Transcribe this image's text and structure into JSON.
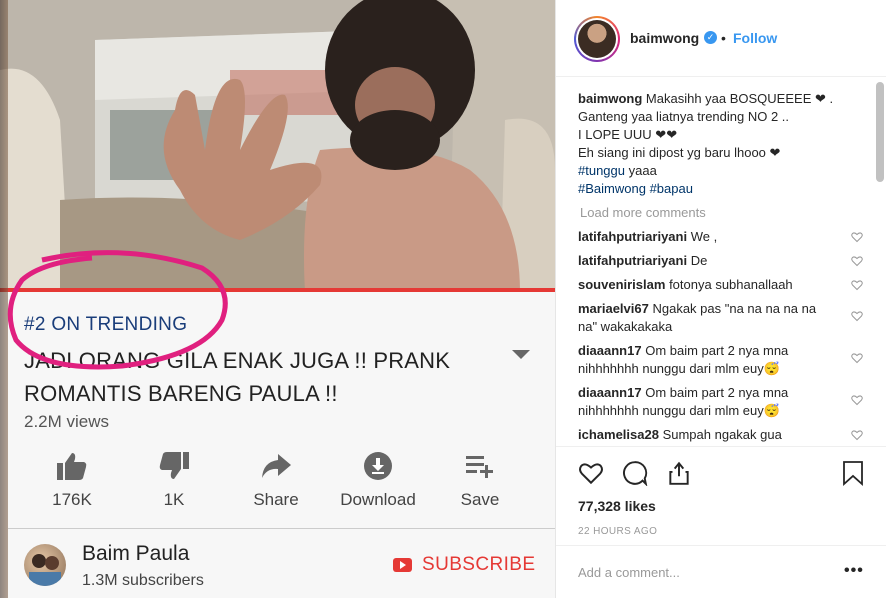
{
  "youtube": {
    "trending_tag": "#2 ON TRENDING",
    "video_title": "JADI ORANG GILA ENAK JUGA !! PRANK ROMANTIS BARENG PAULA !!",
    "views": "2.2M views",
    "actions": [
      {
        "label": "176K",
        "icon": "thumbs-up-icon"
      },
      {
        "label": "1K",
        "icon": "thumbs-down-icon"
      },
      {
        "label": "Share",
        "icon": "share-icon"
      },
      {
        "label": "Download",
        "icon": "download-icon"
      },
      {
        "label": "Save",
        "icon": "playlist-add-icon"
      }
    ],
    "channel": {
      "name": "Baim Paula",
      "subscribers": "1.3M subscribers",
      "subscribe_label": "SUBSCRIBE"
    },
    "accent_color": "#e53935",
    "annotation_circle_color": "#e0207f"
  },
  "instagram": {
    "username": "baimwong",
    "follow_separator": "•",
    "follow_label": "Follow",
    "caption": {
      "user": "baimwong",
      "lines": [
        "Makasihh yaa BOSQUEEEE ❤ . Ganteng yaa liatnya trending NO 2 ..",
        "I LOPE UUU ❤❤",
        "Eh siang ini dipost yg baru lhooo ❤"
      ],
      "tag_line_1_tag": "#tunggu",
      "tag_line_1_rest": " yaaa",
      "tag_line_2_tag_a": "#Baimwong",
      "tag_line_2_tag_b": "#bapau"
    },
    "load_more": "Load more comments",
    "comments": [
      {
        "user": "latifahputriariyani",
        "text": "We ,"
      },
      {
        "user": "latifahputriariyani",
        "text": "De"
      },
      {
        "user": "souvenirislam",
        "text": "fotonya subhanallaah"
      },
      {
        "user": "mariaelvi67",
        "text": "Ngakak pas \"na na na na na na\" wakakakaka"
      },
      {
        "user": "diaaann17",
        "text": "Om baim part 2 nya mna nihhhhhhh nunggu dari mlm euy😴"
      },
      {
        "user": "diaaann17",
        "text": "Om baim part 2 nya mna nihhhhhhh nunggu dari mlm euy😴"
      },
      {
        "user": "ichamelisa28",
        "text": "Sumpah ngakak gua"
      }
    ],
    "likes": "77,328 likes",
    "time_ago": "22 HOURS AGO",
    "add_comment_placeholder": "Add a comment...",
    "more_label": "•••",
    "link_color": "#3897f0",
    "hashtag_color": "#003569"
  }
}
